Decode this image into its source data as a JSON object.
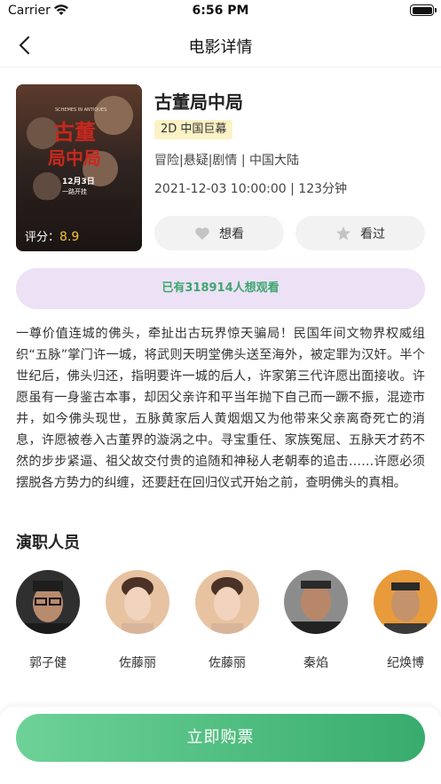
{
  "status_bar": {
    "carrier": "Carrier",
    "time": "6:56 PM",
    "battery": 1.0
  },
  "nav": {
    "title": "电影详情",
    "back_icon": "chevron-left-icon"
  },
  "movie": {
    "title": "古董局中局",
    "tag": "2D 中国巨幕",
    "genre_region": "冒险|悬疑|剧情 | 中国大陆",
    "release_duration": "2021-12-03 10:00:00 | 123分钟",
    "rating_label": "评分：",
    "rating_value": "8.9",
    "poster_title": "古董局中局",
    "poster_subtitle": "SCHEMES IN ANTIQUES",
    "poster_date": "12月3日",
    "poster_date_sub": "一路开挂"
  },
  "actions": {
    "want_label": "想看",
    "want_icon": "heart-icon",
    "seen_label": "看过",
    "seen_icon": "star-icon"
  },
  "want_banner": "已有318914人想观看",
  "synopsis": "一尊价值连城的佛头，牵扯出古玩界惊天骗局！民国年间文物界权威组织“五脉”掌门许一城，将武则天明堂佛头送至海外，被定罪为汉奸。半个世纪后，佛头归还，指明要许一城的后人，许家第三代许愿出面接收。许愿虽有一身鉴古本事，却因父亲许和平当年抛下自己而一蹶不振，混迹市井，如今佛头现世，五脉黄家后人黄烟烟又为他带来父亲离奇死亡的消息，许愿被卷入古董界的漩涡之中。寻宝重任、家族冤屈、五脉天才药不然的步步紧逼、祖父故交付贵的追随和神秘人老朝奉的追击……许愿必须摆脱各方势力的纠缠，还要赶在回归仪式开始之前，查明佛头的真相。",
  "cast": {
    "heading": "演职人员",
    "members": [
      {
        "name": "郭子健"
      },
      {
        "name": "佐藤丽"
      },
      {
        "name": "佐藤丽"
      },
      {
        "name": "秦焰"
      },
      {
        "name": "纪焕博"
      }
    ]
  },
  "buy_button": "立即购票",
  "colors": {
    "accent_green": "#3ea56f",
    "banner_bg": "#ece1f5",
    "tag_bg": "#fbf2c6",
    "rating_yellow": "#f5c430"
  }
}
